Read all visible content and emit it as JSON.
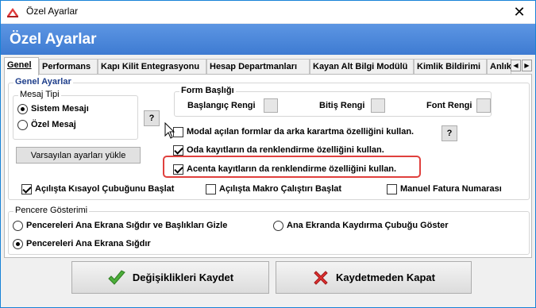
{
  "window": {
    "title": "Özel Ayarlar",
    "close_glyph": "✕"
  },
  "header": {
    "title": "Özel Ayarlar"
  },
  "tabs": [
    {
      "label": "Genel"
    },
    {
      "label": "Performans"
    },
    {
      "label": "Kapı Kilit Entegrasyonu"
    },
    {
      "label": "Hesap Departmanları"
    },
    {
      "label": "Kayan Alt Bilgi Modülü"
    },
    {
      "label": "Kimlik Bildirimi"
    },
    {
      "label": "Anlık"
    }
  ],
  "tab_scroll": {
    "left": "◀",
    "right": "▶"
  },
  "genel_ayarlar": {
    "label": "Genel Ayarlar",
    "mesaj_tipi": {
      "label": "Mesaj Tipi",
      "options": [
        {
          "label": "Sistem Mesajı",
          "checked": true
        },
        {
          "label": "Özel Mesaj",
          "checked": false
        }
      ],
      "help": "?"
    },
    "default_button": "Varsayılan ayarları yükle",
    "form_basligi": {
      "label": "Form Başlığı",
      "start_color": "Başlangıç Rengi",
      "end_color": "Bitiş Rengi",
      "font_color": "Font Rengi"
    },
    "checks": {
      "modal": {
        "label": "Modal açılan formlar da arka karartma özelliğini kullan.",
        "checked": false
      },
      "modal_help": "?",
      "oda": {
        "label": "Oda kayıtların da renklendirme özelliğini kullan.",
        "checked": true
      },
      "acenta": {
        "label": "Acenta kayıtların da renklendirme özelliğini kullan.",
        "checked": true
      },
      "kisayol": {
        "label": "Açılışta Kısayol Çubuğunu Başlat",
        "checked": true
      },
      "makro": {
        "label": "Açılışta Makro Çalıştırı Başlat",
        "checked": false
      },
      "manuel": {
        "label": "Manuel Fatura Numarası",
        "checked": false
      }
    }
  },
  "pencere": {
    "label": "Pencere Gösterimi",
    "options": [
      {
        "label": "Pencereleri Ana Ekrana Sığdır ve Başlıkları Gizle",
        "checked": false
      },
      {
        "label": "Ana Ekranda Kaydırma Çubuğu Göster",
        "checked": false
      },
      {
        "label": "Pencereleri Ana Ekrana Sığdır",
        "checked": true
      }
    ]
  },
  "footer": {
    "save": "Değişiklikleri Kaydet",
    "cancel": "Kaydetmeden Kapat"
  },
  "colors": {
    "header": "#3e7bd2",
    "group_label": "#1f3f8b",
    "highlight": "#e0403d",
    "save_icon": "#4cae3a",
    "cancel_icon": "#e03030"
  }
}
